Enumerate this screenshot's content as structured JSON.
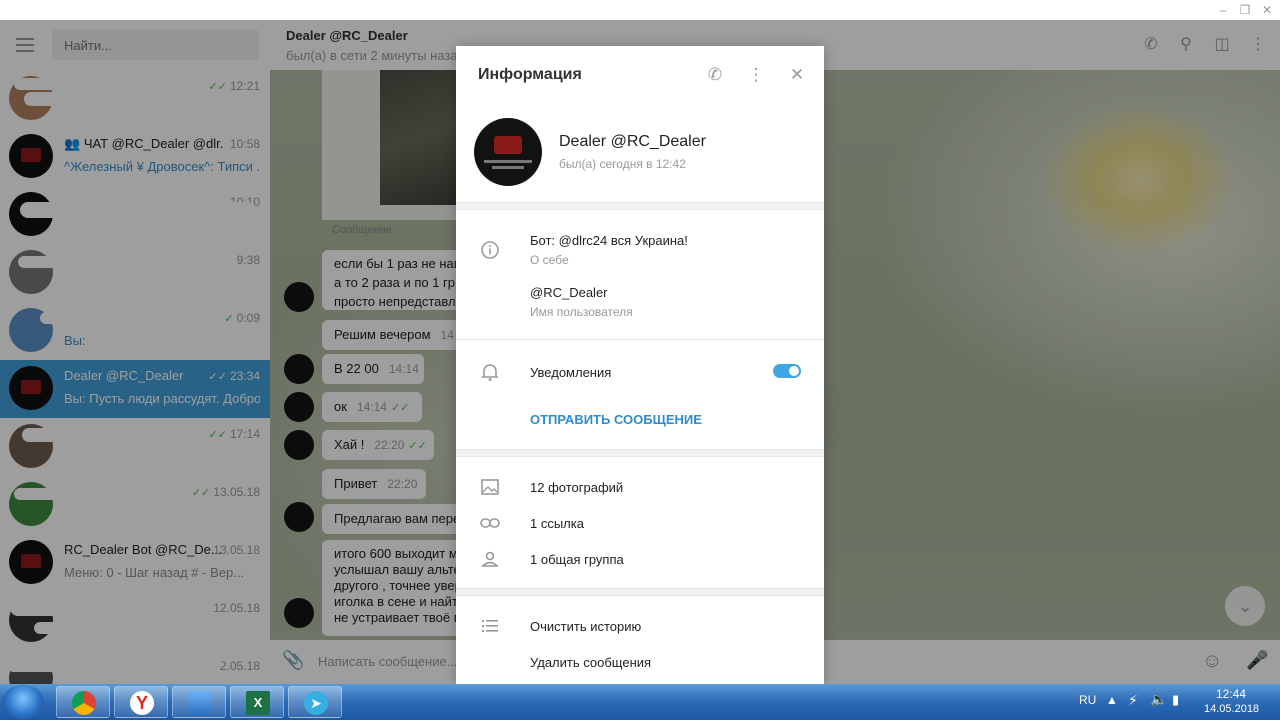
{
  "search": {
    "placeholder": "Найти..."
  },
  "dialogs": [
    {
      "title": "",
      "time": "12:21",
      "text": "",
      "read": true,
      "active": false
    },
    {
      "title": "ЧАТ @RC_Dealer @dlr...",
      "time": "10:58",
      "text": "^Железный ¥ Дровосек^: Типси ...",
      "read": false,
      "active": false
    },
    {
      "title": "",
      "time": "10:10",
      "text": "",
      "read": false,
      "active": false
    },
    {
      "title": "",
      "time": "9:38",
      "text": "",
      "read": false,
      "active": false
    },
    {
      "title": "",
      "time": "0:09",
      "text": "Вы:",
      "read": true,
      "active": false
    },
    {
      "title": "Dealer @RC_Dealer",
      "time": "23:34",
      "text": "Вы: Пусть люди рассудят. Добро...",
      "read": true,
      "active": true
    },
    {
      "title": "",
      "time": "17:14",
      "text": "",
      "read": true,
      "active": false
    },
    {
      "title": "",
      "time": "13.05.18",
      "text": "",
      "read": true,
      "active": false
    },
    {
      "title": "RC_Dealer Bot @RC_De...",
      "time": "13.05.18",
      "text": "Меню: 0 - Шаг назад # - Вер...",
      "read": false,
      "active": false
    },
    {
      "title": "",
      "time": "12.05.18",
      "text": "",
      "read": false,
      "active": false
    },
    {
      "title": "",
      "time": "12.05.18",
      "text": "",
      "read": false,
      "active": false
    }
  ],
  "chat": {
    "title": "Dealer @RC_Dealer",
    "status": "был(а) в сети 2 минуты назад",
    "photo_caption": "Сообщение",
    "composer_placeholder": "Написать сообщение...",
    "messages": [
      {
        "text": "если бы 1 раз не наш",
        "line2": "а то 2 раза и по 1 гр.",
        "line3": "просто непредставля"
      },
      {
        "text": "Решим вечером",
        "time": "14"
      },
      {
        "text": "В 22 00",
        "time": "14:14"
      },
      {
        "text": "ок",
        "time": "14:14"
      },
      {
        "text": "Хай !",
        "time": "22:20"
      },
      {
        "text": "Привет",
        "time": "22:20"
      },
      {
        "text": "Предлагаю вам пере"
      },
      {
        "text": "итого 600 выходит м",
        "line2": "услышал вашу альте",
        "line3": "другого , точнее увер",
        "line4": "иголка в сене и найт",
        "line5": "не устраивает твоё п"
      }
    ]
  },
  "info": {
    "title": "Информация",
    "name": "Dealer @RC_Dealer",
    "last_seen": "был(а) сегодня в 12:42",
    "bio": "Бот: @dlrc24 вся Украина!",
    "bio_label": "О себе",
    "username": "@RC_Dealer",
    "username_label": "Имя пользователя",
    "notifications_label": "Уведомления",
    "notifications_on": true,
    "send_message": "ОТПРАВИТЬ СООБЩЕНИЕ",
    "photos": "12 фотографий",
    "links": "1 ссылка",
    "groups": "1 общая группа",
    "clear_history": "Очистить историю",
    "delete_messages": "Удалить сообщения"
  },
  "taskbar": {
    "lang": "RU",
    "time": "12:44",
    "date": "14.05.2018"
  },
  "colors": {
    "accent": "#419fd9",
    "link": "#2e8cc8",
    "read_check": "#4dbb5f"
  }
}
